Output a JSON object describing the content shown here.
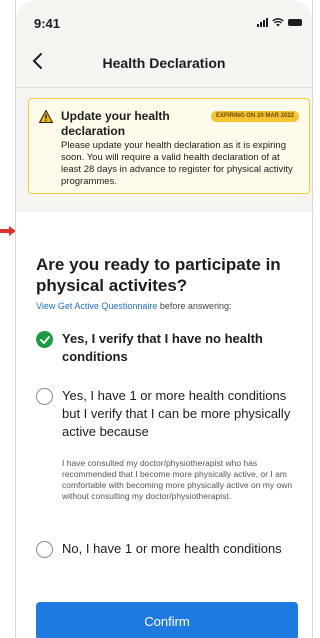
{
  "status_bar": {
    "time": "9:41"
  },
  "nav": {
    "title": "Health Declaration"
  },
  "banner": {
    "title": "Update your health declaration",
    "badge": "EXPIRING ON 20 MAR 2022",
    "body": "Please update your health declaration as it is expiring soon. You will require a valid health declaration of at least 28 days in advance to register for physical activity programmes."
  },
  "question": {
    "title": "Are you ready to participate in physical activites?",
    "link": "View Get Active Questionnaire",
    "helper_rest": " before answering:"
  },
  "options": [
    {
      "label": "Yes, I verify that I have no health conditions",
      "checked": true
    },
    {
      "label": "Yes, I have 1 or more health conditions but I verify that I can be more physically active because",
      "checked": false,
      "sub": "I have consulted my doctor/physiotherapist who has recommended that I become more physically active, or I am comfortable with becoming more physically active on my own without consulting my doctor/physiotherapist."
    },
    {
      "label": "No, I have 1 or more health conditions",
      "checked": false
    }
  ],
  "confirm_label": "Confirm",
  "colors": {
    "accent": "#1f7ae0",
    "success": "#1e9a45",
    "warning": "#f2cc3c",
    "arrow": "#d9352b"
  }
}
